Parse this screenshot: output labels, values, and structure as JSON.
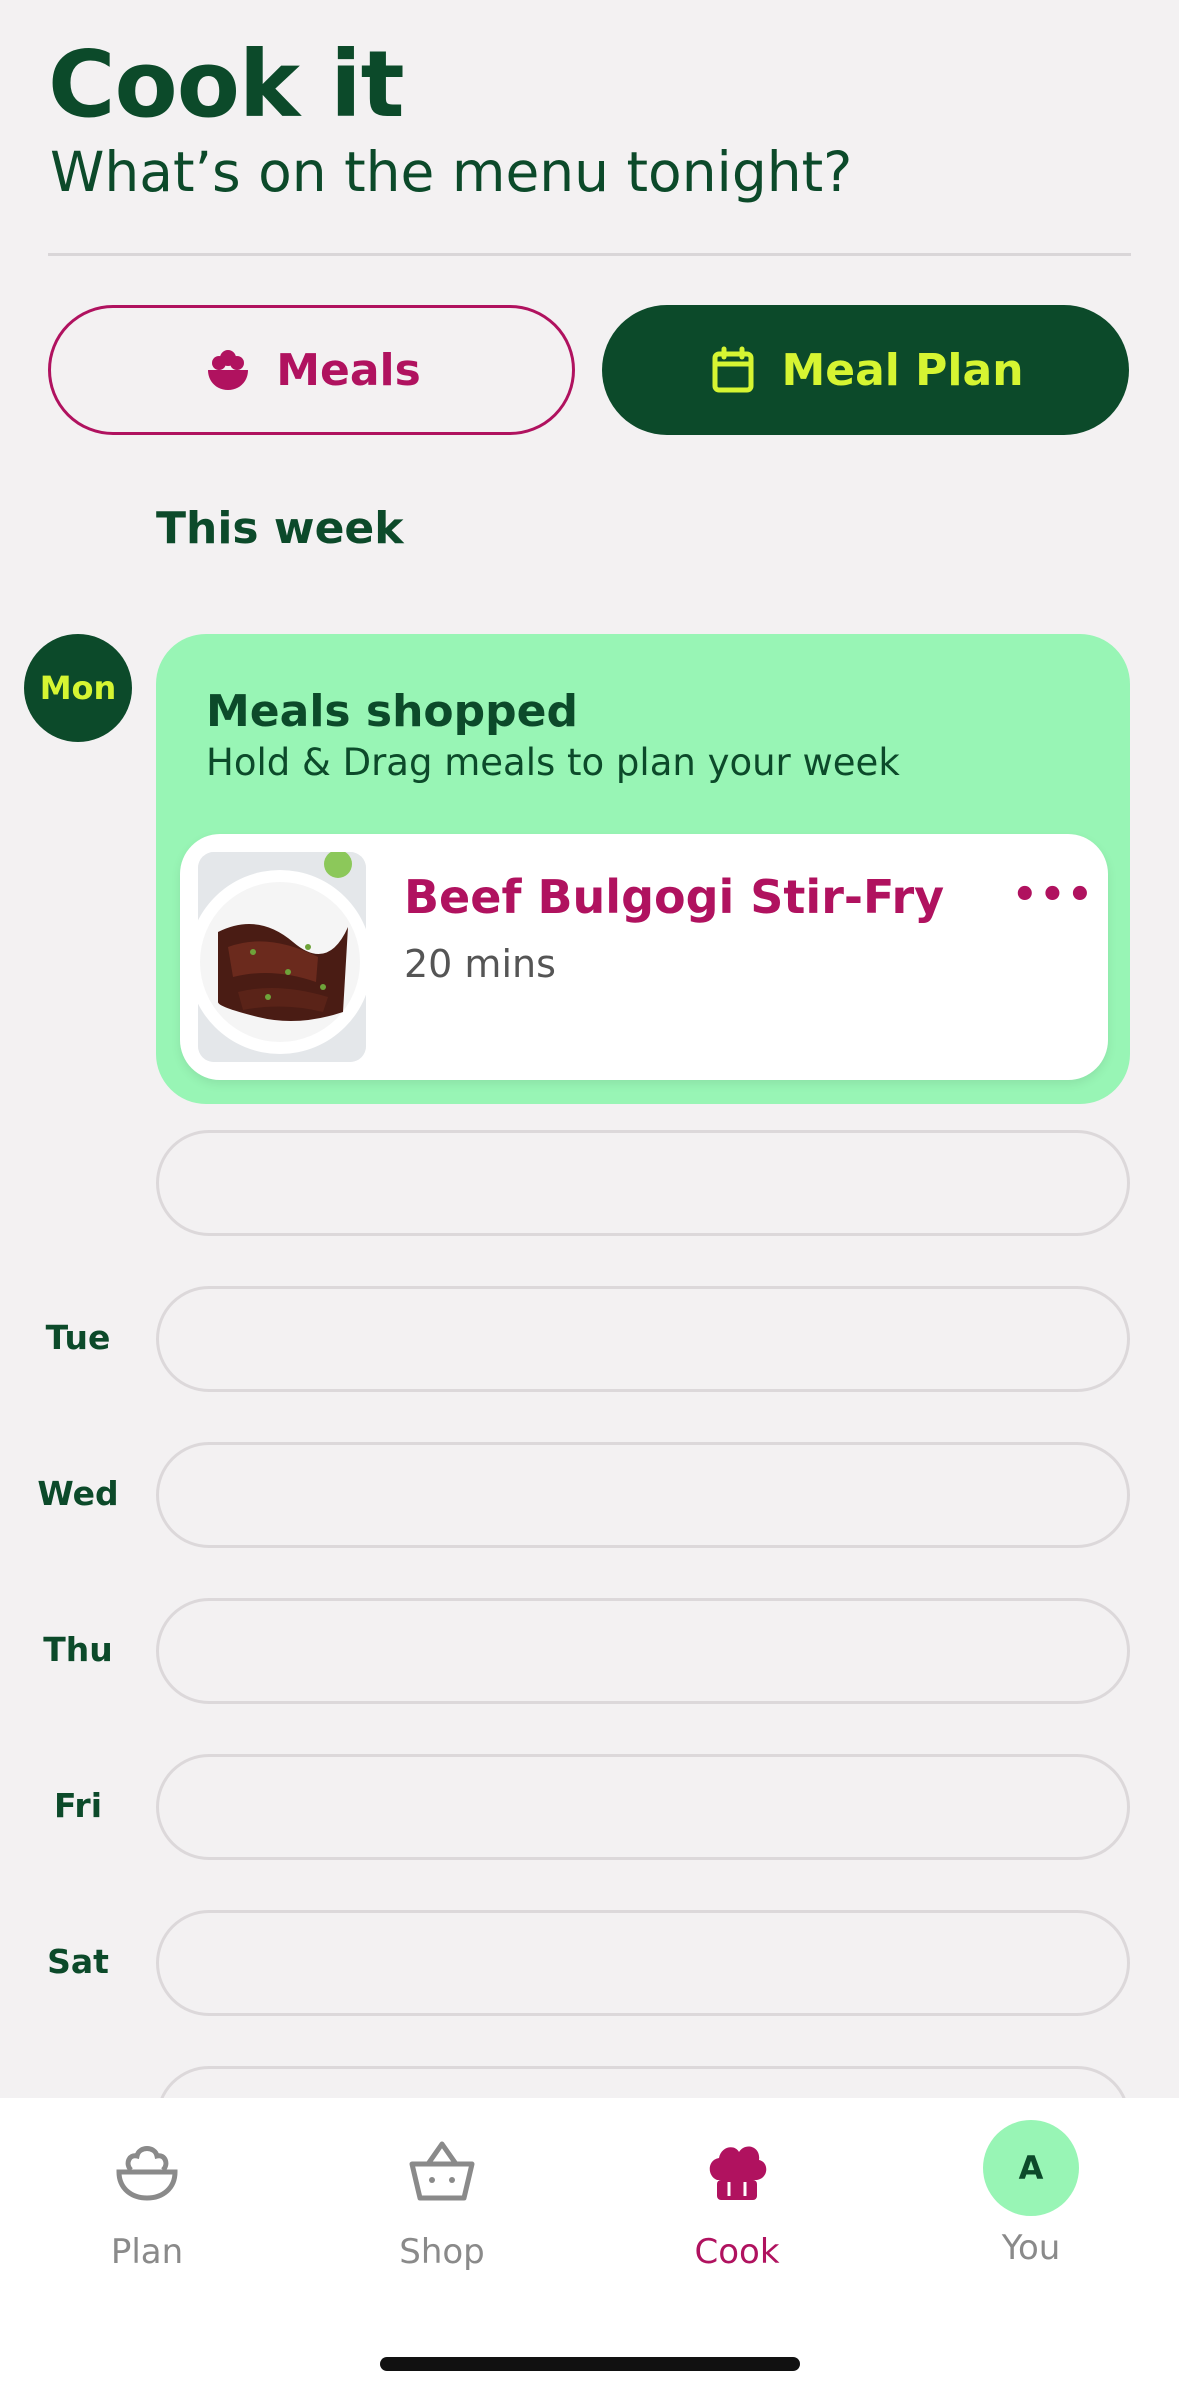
{
  "header": {
    "title": "Cook it",
    "subtitle": "What’s on the menu tonight?"
  },
  "segments": {
    "meals_label": "Meals",
    "meals_icon": "bowl-icon",
    "plan_label": "Meal Plan",
    "plan_icon": "calendar-icon",
    "active": "Meal Plan"
  },
  "week": {
    "label": "This week",
    "days": [
      "Mon",
      "Tue",
      "Wed",
      "Thu",
      "Fri",
      "Sat"
    ]
  },
  "shopped": {
    "title": "Meals shopped",
    "subtitle": "Hold & Drag meals to plan your week"
  },
  "meal": {
    "name": "Beef Bulgogi Stir-Fry",
    "time": "20 mins",
    "menu": "•••"
  },
  "tabbar": {
    "tabs": [
      {
        "label": "Plan",
        "icon": "bowl-icon"
      },
      {
        "label": "Shop",
        "icon": "basket-icon"
      },
      {
        "label": "Cook",
        "icon": "chef-hat-icon"
      },
      {
        "label": "You",
        "icon": "avatar"
      }
    ],
    "active": "Cook",
    "avatar_initial": "A"
  },
  "colors": {
    "primary": "#0c4a2a",
    "accent": "#b0125f",
    "highlight": "#d6f532",
    "mint": "#98f5b5"
  }
}
